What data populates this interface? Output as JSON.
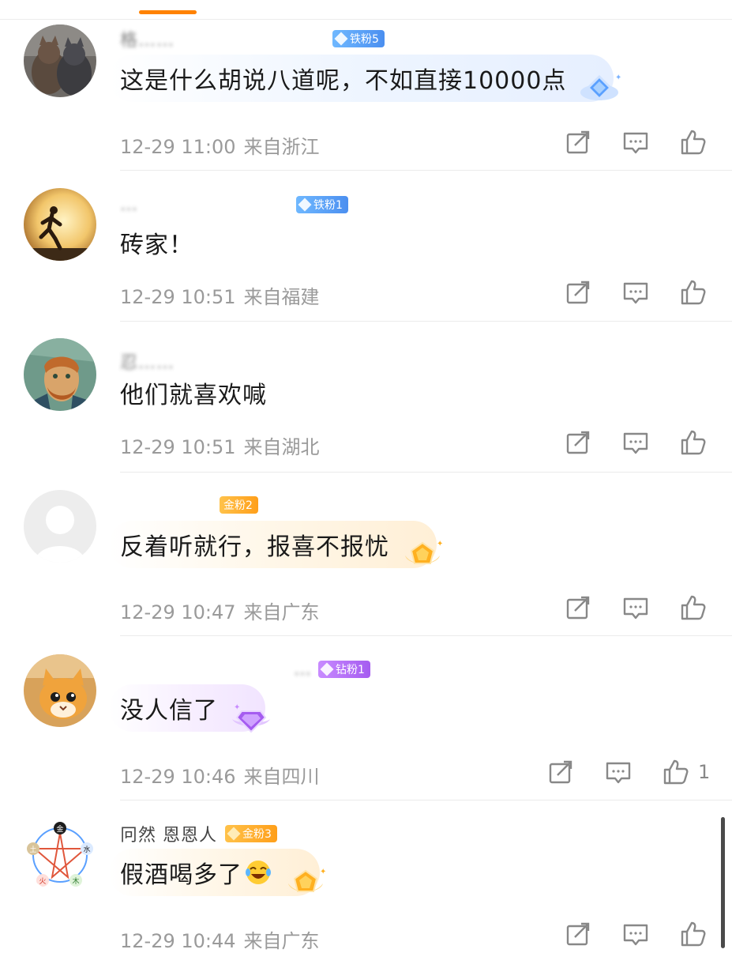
{
  "header": {
    "active_tab_color": "#ff8200"
  },
  "comments": [
    {
      "username": "格……",
      "badge": {
        "label": "铁粉5",
        "tier": "iron",
        "color": "#4b8ff0"
      },
      "text": "这是什么胡说八道呢，不如直接10000点",
      "time": "12-29 11:00",
      "location": "来自浙江",
      "likes": "",
      "avatar": "two-cats-avatar"
    },
    {
      "username": "…",
      "badge": {
        "label": "铁粉1",
        "tier": "iron",
        "color": "#4b8ff0"
      },
      "text": "砖家！",
      "time": "12-29 10:51",
      "location": "来自福建",
      "likes": "",
      "avatar": "runner-sunset-avatar"
    },
    {
      "username": "忍……",
      "badge": null,
      "text": "他们就喜欢喊",
      "time": "12-29 10:51",
      "location": "来自湖北",
      "likes": "",
      "avatar": "van-gogh-portrait-avatar"
    },
    {
      "username": "",
      "badge": {
        "label": "金粉2",
        "tier": "gold",
        "color": "#ff9f1a"
      },
      "text": "反着听就行，报喜不报忧",
      "time": "12-29 10:47",
      "location": "来自广东",
      "likes": "",
      "avatar": "default-user-avatar"
    },
    {
      "username": "…",
      "badge": {
        "label": "钻粉1",
        "tier": "diamond",
        "color": "#a55cf0"
      },
      "text": "没人信了",
      "time": "12-29 10:46",
      "location": "来自四川",
      "likes": "1",
      "avatar": "orange-cat-avatar"
    },
    {
      "username": "冋然 恩恩人",
      "badge": {
        "label": "金粉3",
        "tier": "gold",
        "color": "#ff9f1a"
      },
      "text": "假酒喝多了",
      "emoji": "laughing-crying-emoji",
      "time": "12-29 10:44",
      "location": "来自广东",
      "likes": "",
      "avatar": "five-elements-chart-avatar",
      "five_elements": [
        "金",
        "水",
        "木",
        "火",
        "土"
      ]
    }
  ],
  "icons": {
    "repost": "repost-icon",
    "comment": "comment-icon",
    "like": "like-icon"
  }
}
